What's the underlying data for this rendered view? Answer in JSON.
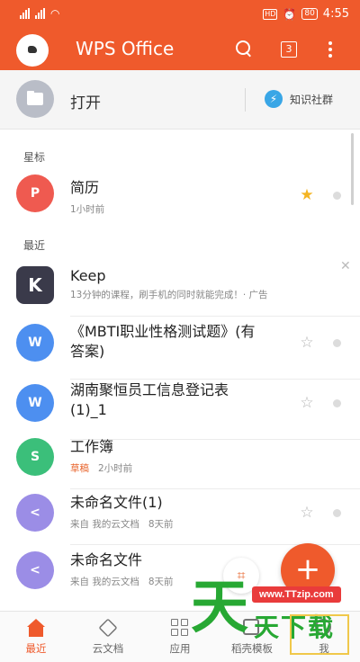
{
  "status_bar": {
    "time": "4:55",
    "battery": "80",
    "hd_label": "HD"
  },
  "app_bar": {
    "title": "WPS Office",
    "tab_count": "3",
    "accent": "#ef5a2c"
  },
  "open_row": {
    "label": "打开",
    "community": "知识社群"
  },
  "sections": {
    "starred": "星标",
    "recent": "最近"
  },
  "starred_items": [
    {
      "title": "简历",
      "subtitle": "1小时前",
      "icon": "pdf-icon",
      "color": "#ef5a50",
      "starred": true
    }
  ],
  "recent_items": [
    {
      "title": "Keep",
      "subtitle": "13分钟的课程，刷手机的同时就能完成！· 广告",
      "icon": "keep-logo",
      "color": "#3a3a4a"
    },
    {
      "title": "《MBTI职业性格测试题》(有答案)",
      "title_line1": "《MBTI职业性格测试题》(有",
      "title_line2": "答案)",
      "icon": "word-icon",
      "color": "#4d8ff0"
    },
    {
      "title": "湖南聚恒员工信息登记表(1)_1",
      "title_line1": "湖南聚恒员工信息登记表",
      "title_line2": "(1)_1",
      "icon": "word-icon",
      "color": "#4d8ff0"
    },
    {
      "title": "工作簿",
      "tag": "草稿",
      "time": "2小时前",
      "icon": "sheet-icon",
      "color": "#3bbf7a"
    },
    {
      "title": "未命名文件(1)",
      "source": "来自 我的云文档",
      "time": "8天前",
      "icon": "share-icon",
      "color": "#9b8de6"
    },
    {
      "title": "未命名文件",
      "source": "来自 我的云文档",
      "time": "8天前",
      "icon": "share-icon",
      "color": "#9b8de6"
    }
  ],
  "fab": {
    "label": "+"
  },
  "bottom_nav": [
    {
      "label": "最近",
      "icon": "home-icon",
      "active": true
    },
    {
      "label": "云文档",
      "icon": "cloud-doc-icon",
      "active": false
    },
    {
      "label": "应用",
      "icon": "apps-grid-icon",
      "active": false
    },
    {
      "label": "稻壳模板",
      "icon": "template-icon",
      "active": false
    },
    {
      "label": "我",
      "icon": "profile-icon",
      "active": false
    }
  ],
  "watermark": {
    "url": "www.TTzip.com",
    "big": "天",
    "small": "天下载"
  }
}
